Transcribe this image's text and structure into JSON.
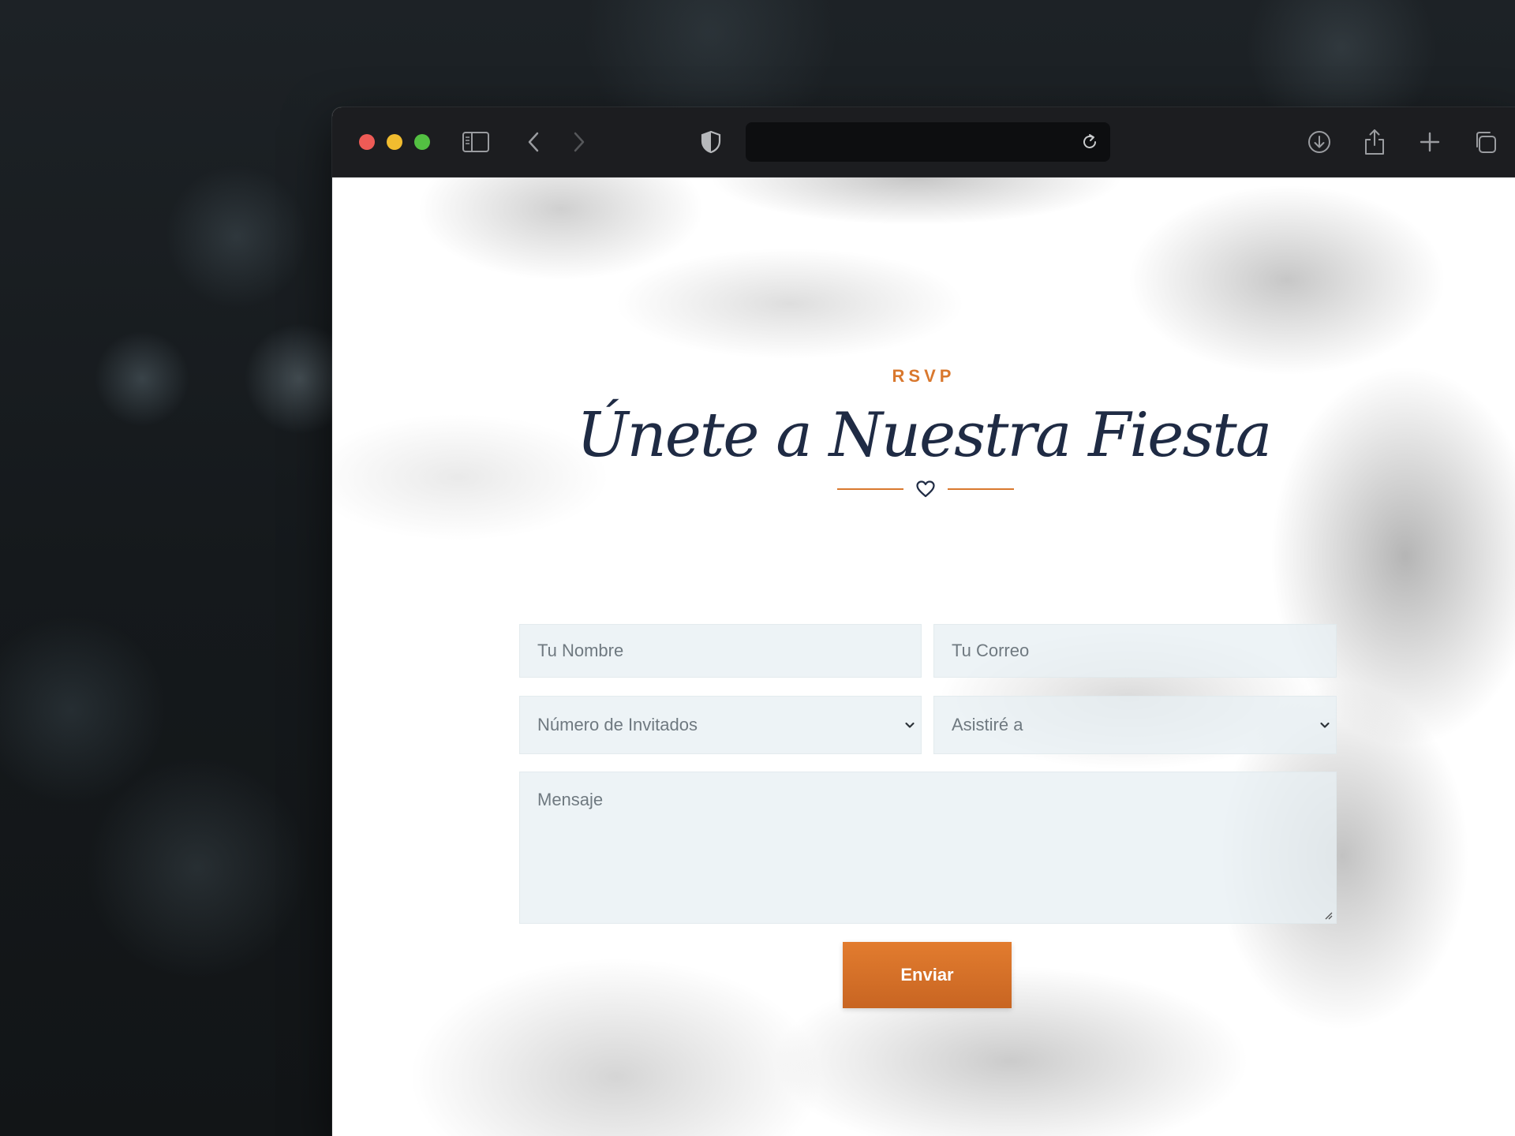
{
  "browser": {
    "address": "",
    "toolbar_icons": [
      "sidebar-icon",
      "back-icon",
      "forward-icon",
      "shield-icon",
      "reload-icon",
      "download-icon",
      "share-icon",
      "new-tab-icon",
      "tabs-overview-icon"
    ]
  },
  "rsvp": {
    "eyebrow": "RSVP",
    "heading": "Únete a Nuestra Fiesta",
    "accent_color": "#d9782e",
    "heading_color": "#1f2b44",
    "divider_icon": "heart-icon"
  },
  "form": {
    "name_placeholder": "Tu Nombre",
    "email_placeholder": "Tu Correo",
    "guests_selected": "Número de Invitados",
    "attend_selected": "Asistiré a",
    "message_placeholder": "Mensaje",
    "submit_label": "Enviar"
  }
}
